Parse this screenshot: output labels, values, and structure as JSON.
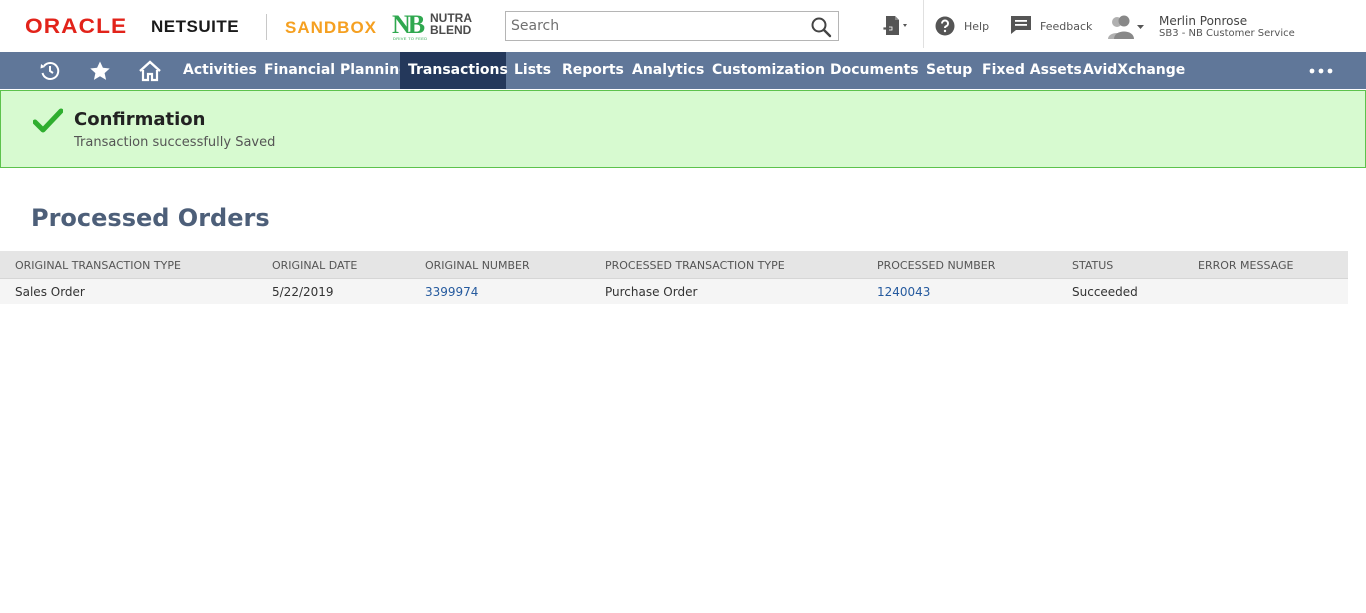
{
  "header": {
    "oracle_logo": "ORACLE",
    "netsuite_logo": "NETSUITE",
    "environment": "SANDBOX",
    "company_logo": {
      "mark": "NB",
      "line1": "NUTRA",
      "line2": "BLEND",
      "tagline": "DRIVE TO FEED"
    },
    "search": {
      "placeholder": "Search",
      "value": ""
    },
    "create_icon": "add-document-icon",
    "help_label": "Help",
    "feedback_label": "Feedback",
    "user": {
      "name": "Merlin Ponrose",
      "role": "SB3 - NB Customer Service"
    }
  },
  "nav": {
    "icons": [
      "recent-icon",
      "star-icon",
      "home-icon"
    ],
    "items": [
      {
        "label": "Activities"
      },
      {
        "label": "Financial Planning"
      },
      {
        "label": "Transactions",
        "active": true
      },
      {
        "label": "Lists"
      },
      {
        "label": "Reports"
      },
      {
        "label": "Analytics"
      },
      {
        "label": "Customization"
      },
      {
        "label": "Documents"
      },
      {
        "label": "Setup"
      },
      {
        "label": "Fixed Assets"
      },
      {
        "label": "AvidXchange"
      }
    ],
    "more_icon": "more-horizontal-icon"
  },
  "confirmation": {
    "title": "Confirmation",
    "message": "Transaction successfully Saved"
  },
  "page": {
    "title": "Processed Orders"
  },
  "table": {
    "columns": [
      "ORIGINAL TRANSACTION TYPE",
      "ORIGINAL DATE",
      "ORIGINAL NUMBER",
      "PROCESSED TRANSACTION TYPE",
      "PROCESSED NUMBER",
      "STATUS",
      "ERROR MESSAGE"
    ],
    "rows": [
      {
        "original_type": "Sales Order",
        "original_date": "5/22/2019",
        "original_number": "3399974",
        "processed_type": "Purchase Order",
        "processed_number": "1240043",
        "status": "Succeeded",
        "error_message": ""
      }
    ]
  },
  "colors": {
    "nav_bg": "#607799",
    "nav_active_bg": "#24385b",
    "confirm_bg": "#d7fad0",
    "confirm_border": "#5cc24c",
    "link": "#255a9e",
    "brand_red": "#e2231a",
    "sandbox_orange": "#f5a021"
  }
}
